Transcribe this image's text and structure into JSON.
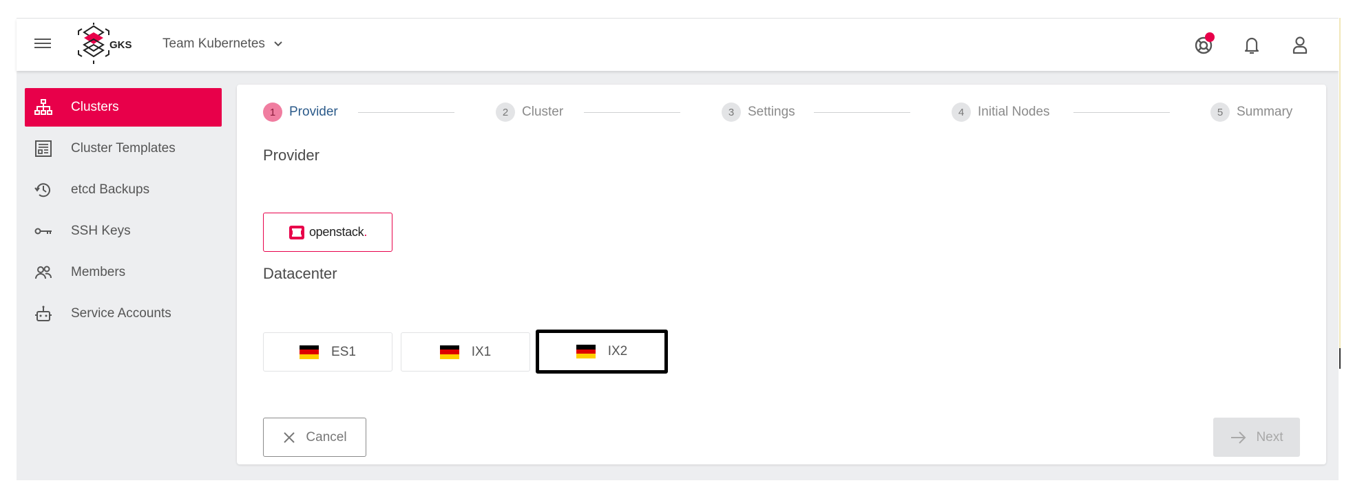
{
  "header": {
    "logo_text": "GKS",
    "team_name": "Team Kubernetes",
    "notification_badge_color": "#e8004a"
  },
  "sidebar": {
    "items": [
      {
        "label": "Clusters",
        "icon": "sitemap-icon",
        "active": true
      },
      {
        "label": "Cluster Templates",
        "icon": "template-icon",
        "active": false
      },
      {
        "label": "etcd Backups",
        "icon": "history-icon",
        "active": false
      },
      {
        "label": "SSH Keys",
        "icon": "key-icon",
        "active": false
      },
      {
        "label": "Members",
        "icon": "members-icon",
        "active": false
      },
      {
        "label": "Service Accounts",
        "icon": "robot-icon",
        "active": false
      }
    ]
  },
  "stepper": {
    "steps": [
      {
        "number": "1",
        "label": "Provider",
        "active": true
      },
      {
        "number": "2",
        "label": "Cluster",
        "active": false
      },
      {
        "number": "3",
        "label": "Settings",
        "active": false
      },
      {
        "number": "4",
        "label": "Initial Nodes",
        "active": false
      },
      {
        "number": "5",
        "label": "Summary",
        "active": false
      }
    ]
  },
  "provider_section": {
    "title": "Provider",
    "selected_provider": "openstack"
  },
  "datacenter_section": {
    "title": "Datacenter",
    "options": [
      {
        "label": "ES1",
        "flag": "germany-flag",
        "selected": false
      },
      {
        "label": "IX1",
        "flag": "germany-flag",
        "selected": false
      },
      {
        "label": "IX2",
        "flag": "germany-flag",
        "selected": true
      }
    ]
  },
  "actions": {
    "cancel_label": "Cancel",
    "next_label": "Next"
  },
  "colors": {
    "accent": "#e8004a",
    "step_active_text": "#2b5a8a"
  }
}
